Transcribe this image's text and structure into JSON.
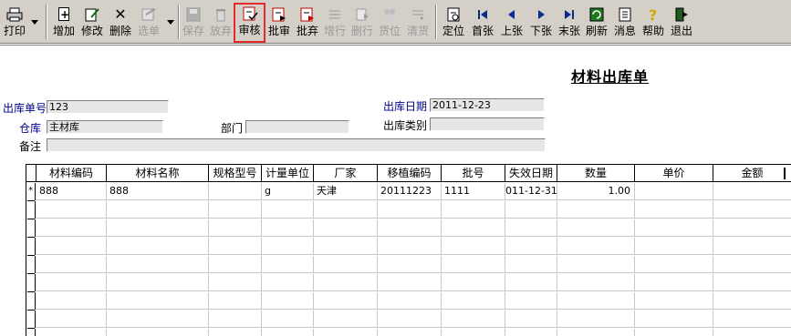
{
  "toolbar": {
    "print": "打印",
    "add": "增加",
    "edit": "修改",
    "delete": "删除",
    "select": "选单",
    "save": "保存",
    "discard": "放弃",
    "audit": "审核",
    "batch_audit": "批审",
    "batch_discard": "批弃",
    "add_row": "增行",
    "delete_row": "删行",
    "stock_position": "货位",
    "clear_goods": "清货",
    "locate": "定位",
    "first": "首张",
    "prev": "上张",
    "next": "下张",
    "last": "末张",
    "refresh": "刷新",
    "message": "消息",
    "help": "帮助",
    "exit": "退出"
  },
  "form": {
    "title": "材料出库单",
    "doc_no_label": "出库单号",
    "doc_no_value": "123",
    "date_label": "出库日期",
    "date_value": "2011-12-23",
    "warehouse_label": "仓库",
    "warehouse_value": "主材库",
    "dept_label": "部门",
    "dept_value": "",
    "type_label": "出库类别",
    "type_value": "",
    "note_label": "备注",
    "note_value": ""
  },
  "grid": {
    "columns": [
      "材料编码",
      "材料名称",
      "规格型号",
      "计量单位",
      "厂家",
      "移植编码",
      "批号",
      "失效日期",
      "数量",
      "单价",
      "金额"
    ],
    "rows": [
      {
        "marker": "*",
        "cells": [
          "888",
          "888",
          "",
          "g",
          "天津",
          "20111223",
          "1111",
          "011-12-31",
          "1.00",
          "",
          ""
        ]
      }
    ]
  },
  "colors": {
    "toolbar_bg": "#d4d0c8",
    "label_blue": "#00008b",
    "highlight": "#e32b2b"
  }
}
